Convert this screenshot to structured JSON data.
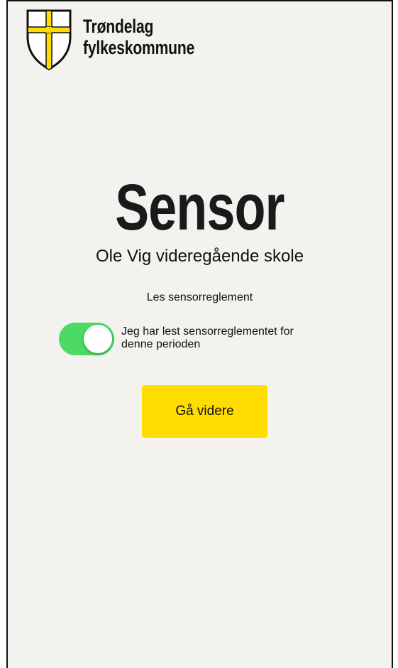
{
  "header": {
    "logo_line1": "Trøndelag",
    "logo_line2": "fylkeskommune",
    "logo_icon": "coat-of-arms-icon"
  },
  "main": {
    "title": "Sensor",
    "subtitle": "Ole Vig videregående skole",
    "read_regulations_link": "Les sensorreglement",
    "confirm_toggle": {
      "checked": true,
      "label": "Jeg har lest sensorreglementet for denne perioden"
    },
    "continue_button": "Gå videre"
  },
  "colors": {
    "background": "#f3f2ef",
    "toggle_on": "#4cd964",
    "button": "#ffdd00",
    "logo_yellow": "#ffdd00"
  }
}
